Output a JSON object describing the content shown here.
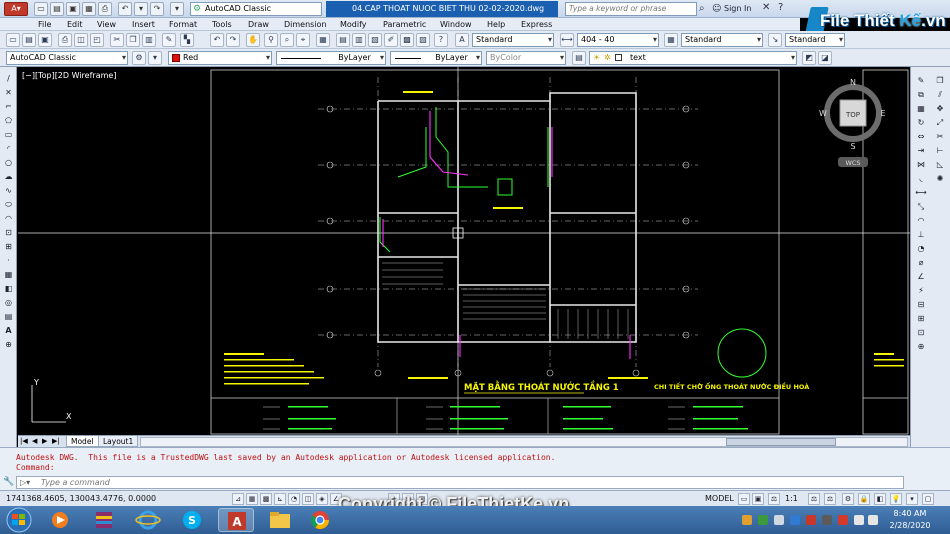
{
  "title_bar": {
    "workspace": "AutoCAD Classic",
    "document_title": "04.CAP THOAT NUOC BIET THU 02-02-2020.dwg",
    "search_placeholder": "Type a keyword or phrase",
    "sign_in": "Sign In"
  },
  "logo": {
    "part1": "File",
    "part2": "Thiết",
    "part3": "Kế",
    "part4": ".vn"
  },
  "menu": [
    "File",
    "Edit",
    "View",
    "Insert",
    "Format",
    "Tools",
    "Draw",
    "Dimension",
    "Modify",
    "Parametric",
    "Window",
    "Help",
    "Express"
  ],
  "toolbar1": {
    "text_style": "Standard",
    "dim_style": "404 - 40",
    "table_style": "Standard",
    "multileader_style": "Standard"
  },
  "toolbar2": {
    "workspace": "AutoCAD Classic",
    "color": "Red",
    "linetype": "ByLayer",
    "lineweight": "ByLayer",
    "plotstyle": "ByColor",
    "layer": "text"
  },
  "viewport": {
    "label": "[−][Top][2D Wireframe]"
  },
  "viewcube": {
    "north": "N",
    "south": "S",
    "east": "E",
    "west": "W",
    "top": "TOP",
    "wcs": "WCS"
  },
  "drawing": {
    "plan_title": "MẶT BẰNG THOÁT NƯỚC TẦNG 1",
    "detail_title": "CHI TIẾT CHỜ ỐNG THOÁT NƯỚC ĐIỀU HOÀ"
  },
  "tabs": {
    "model": "Model",
    "layout1": "Layout1"
  },
  "command": {
    "message": "Autodesk DWG.  This file is a TrustedDWG last saved by an Autodesk application or Autodesk licensed application.",
    "prompt": "Command:",
    "placeholder": "Type a command"
  },
  "status": {
    "coords": "1741368.4605, 130043.4776, 0.0000",
    "model": "MODEL",
    "scale": "1:1"
  },
  "watermark": "Copyright © FileThietKe.vn",
  "clock": {
    "time": "8:40 AM",
    "date": "2/28/2020"
  },
  "colors": {
    "accent": "#1b5fb0",
    "cad_green": "#31ff31",
    "cad_magenta": "#ff30ff",
    "cad_yellow": "#f5f500"
  }
}
